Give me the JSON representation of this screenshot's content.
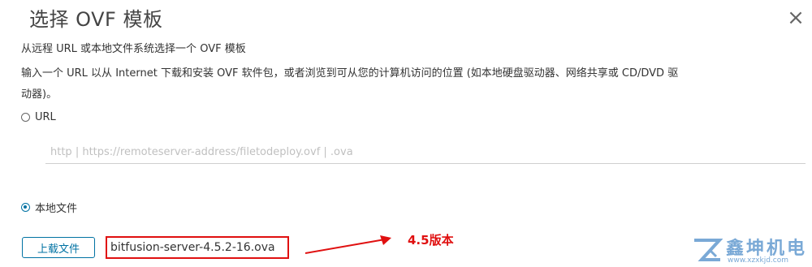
{
  "dialog": {
    "title": "选择 OVF 模板",
    "close_symbol": "×"
  },
  "subtitle": "从远程 URL 或本地文件系统选择一个 OVF 模板",
  "description": "输入一个 URL 以从 Internet 下载和安装 OVF 软件包，或者浏览到可从您的计算机访问的位置 (如本地硬盘驱动器、网络共享或 CD/DVD 驱",
  "description_continued": "动器)。",
  "options": {
    "url": {
      "label": "URL",
      "selected": false
    },
    "local_file": {
      "label": "本地文件",
      "selected": true
    }
  },
  "url_input": {
    "placeholder": "http | https://remoteserver-address/filetodeploy.ovf | .ova",
    "value": ""
  },
  "upload_button": {
    "label": "上载文件"
  },
  "selected_file": "bitfusion-server-4.5.2-16.ova",
  "annotation": {
    "text": "4.5版本",
    "color": "#e01010"
  },
  "watermark": {
    "brand": "鑫坤机电",
    "url": "www.xzxkjd.com"
  },
  "colors": {
    "accent": "#0072a3",
    "annotation_red": "#e01010",
    "watermark_blue": "#7aa9d6"
  }
}
